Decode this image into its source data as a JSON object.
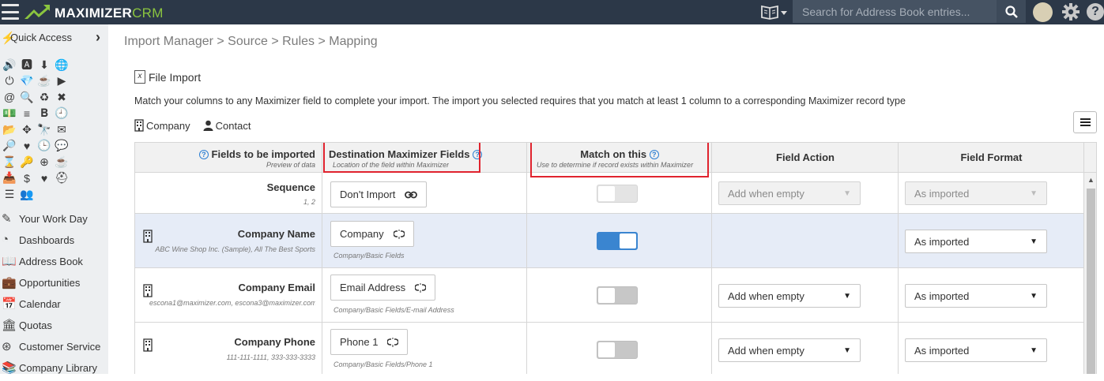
{
  "header": {
    "logo_main": "MAXIMIZER",
    "logo_crm": "CRM",
    "search_placeholder": "Search for Address Book entries...",
    "icons": [
      "hamburger-icon",
      "address-book-icon",
      "search-icon",
      "avatar",
      "gear-icon",
      "help-icon"
    ]
  },
  "sidebar": {
    "quick_access": "Quick Access",
    "nav": [
      {
        "label": "Your Work Day",
        "icon": "edit-icon"
      },
      {
        "label": "Dashboards",
        "icon": "dashboard-icon"
      },
      {
        "label": "Address Book",
        "icon": "address-book-icon"
      },
      {
        "label": "Opportunities",
        "icon": "briefcase-icon"
      },
      {
        "label": "Calendar",
        "icon": "calendar-icon"
      },
      {
        "label": "Quotas",
        "icon": "bank-icon"
      },
      {
        "label": "Customer Service",
        "icon": "lifebuoy-icon"
      },
      {
        "label": "Company Library",
        "icon": "library-icon"
      }
    ]
  },
  "breadcrumb": {
    "import_manager": "Import Manager",
    "source": "> Source",
    "rules": "> Rules",
    "mapping": "> Mapping"
  },
  "panel": {
    "title": "File Import",
    "description": "Match your columns to any Maximizer field to complete your import. The import you selected requires that you match at least 1 column to a corresponding Maximizer record type",
    "record_types": [
      "Company",
      "Contact"
    ]
  },
  "columns": {
    "fields": {
      "title": "Fields to be imported",
      "sub": "Preview of data"
    },
    "destination": {
      "title": "Destination Maximizer Fields",
      "sub": "Location of the field within Maximizer"
    },
    "match": {
      "title": "Match on this",
      "sub": "Use to determine if record exists within Maximizer"
    },
    "action": {
      "title": "Field Action"
    },
    "format": {
      "title": "Field Format"
    }
  },
  "rows": [
    {
      "field": "Sequence",
      "preview": "1, 2",
      "destination": "Don't Import",
      "path": "",
      "match": false,
      "match_disabled": true,
      "action": "Add when empty",
      "action_disabled": true,
      "format": "As imported",
      "format_disabled": true,
      "selected": false
    },
    {
      "field": "Company Name",
      "preview": "ABC Wine Shop Inc. (Sample), All The Best Sports",
      "destination": "Company",
      "path": "Company/Basic Fields",
      "match": true,
      "match_disabled": false,
      "action": "",
      "action_disabled": false,
      "format": "As imported",
      "format_disabled": false,
      "selected": true
    },
    {
      "field": "Company Email",
      "preview": "escona1@maximizer.com, escona3@maximizer.com",
      "destination": "Email Address",
      "path": "Company/Basic Fields/E-mail Address",
      "match": false,
      "match_disabled": false,
      "action": "Add when empty",
      "action_disabled": false,
      "format": "As imported",
      "format_disabled": false,
      "selected": false
    },
    {
      "field": "Company Phone",
      "preview": "111-111-1111, 333-333-3333",
      "destination": "Phone 1",
      "path": "Company/Basic Fields/Phone 1",
      "match": false,
      "match_disabled": false,
      "action": "Add when empty",
      "action_disabled": false,
      "format": "As imported",
      "format_disabled": false,
      "selected": false
    }
  ],
  "colors": {
    "topbar": "#2c3848",
    "accent_green": "#8bc53f",
    "toggle_on": "#3a85d0",
    "highlight_box": "#e0232e",
    "selected_row": "#e6ecf7"
  }
}
